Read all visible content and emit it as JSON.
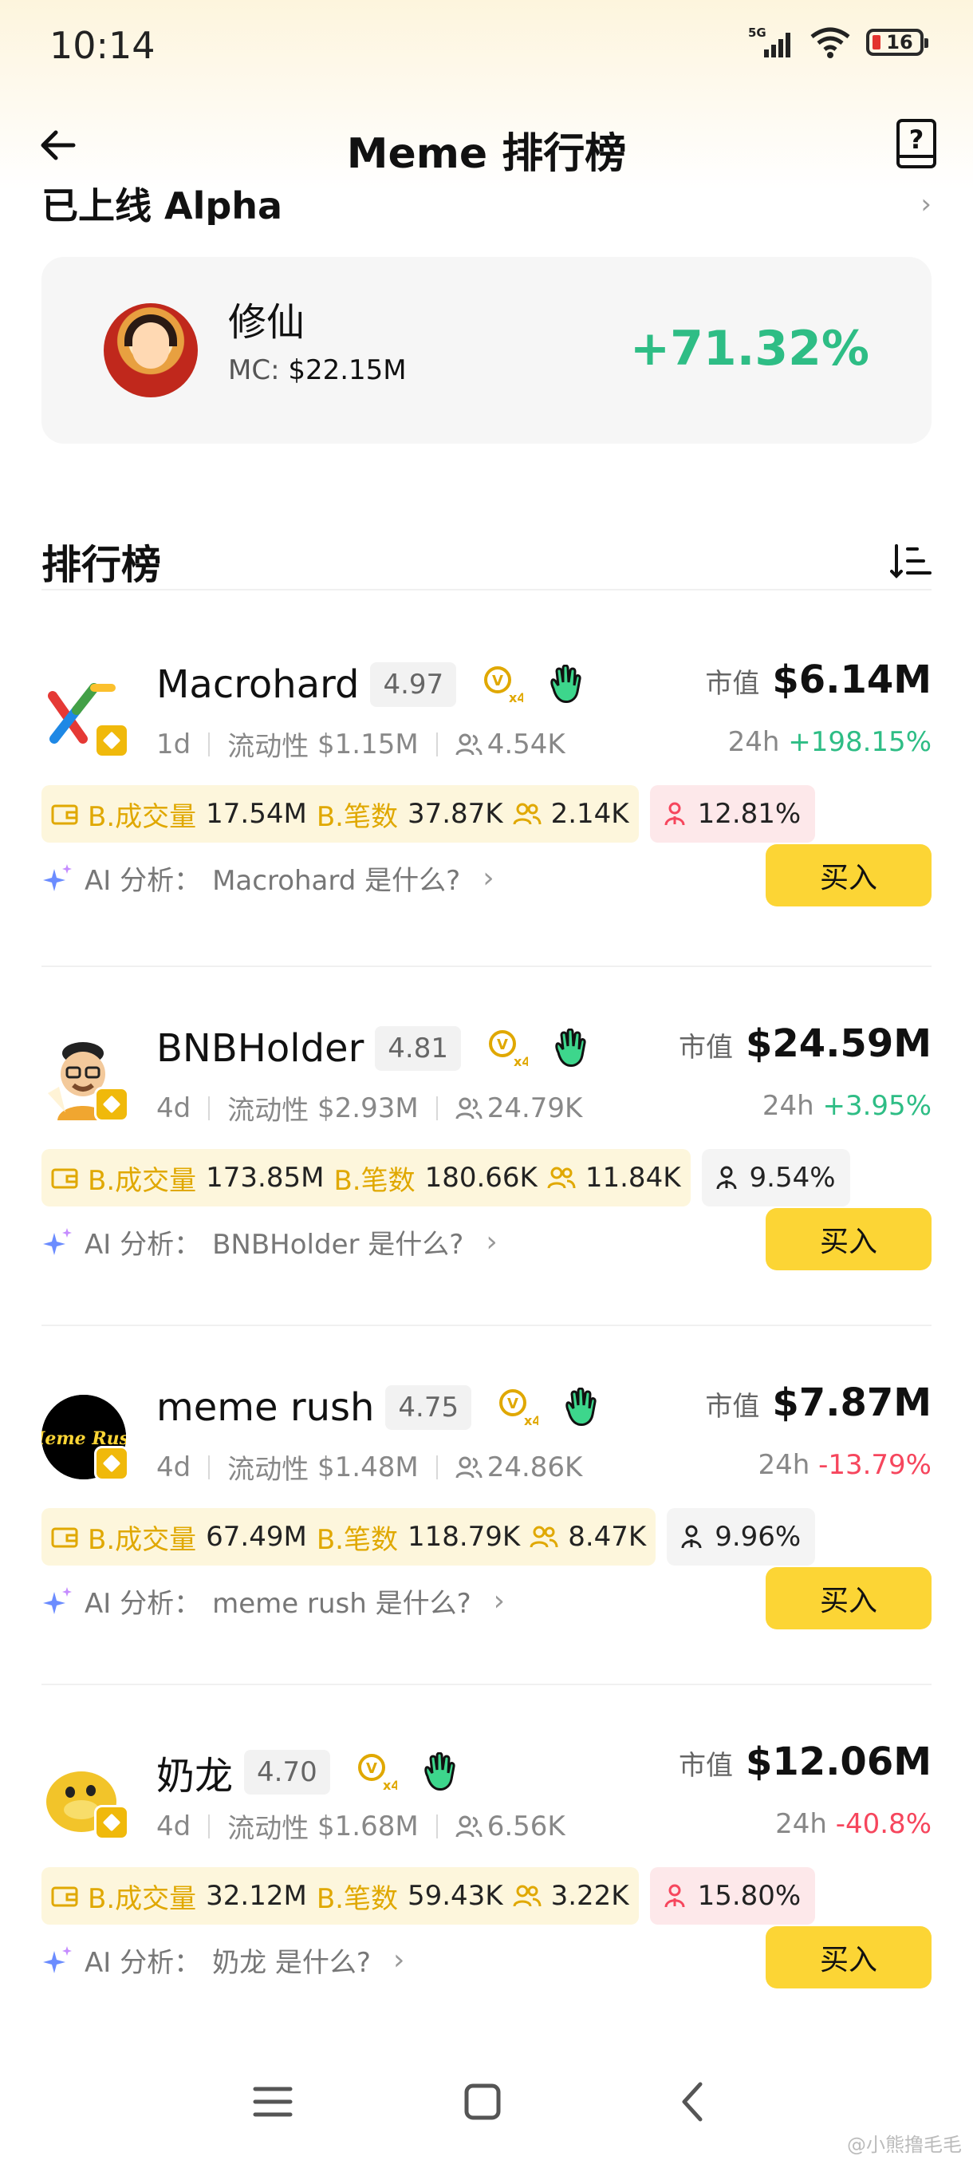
{
  "status_bar": {
    "time": "10:14",
    "network": "5G",
    "battery": "16"
  },
  "header": {
    "title": "Meme 排行榜"
  },
  "alpha": {
    "section_title": "已上线 Alpha",
    "token": {
      "name": "修仙",
      "mc_label": "MC:",
      "mc_value": "$22.15M",
      "change": "+71.32%"
    }
  },
  "ranking": {
    "title": "排行榜",
    "labels": {
      "mcap": "市值",
      "h24": "24h",
      "liquidity": "流动性",
      "volume": "B.成交量",
      "trades": "B.笔数",
      "buy": "买入",
      "ai_prefix": "AI 分析："
    },
    "items": [
      {
        "name": "Macrohard",
        "score": "4.97",
        "age": "1d",
        "liquidity": "$1.15M",
        "holders": "4.54K",
        "mcap": "$6.14M",
        "change": "+198.15%",
        "change_dir": "up",
        "volume": "17.54M",
        "trades": "37.87K",
        "traders": "2.14K",
        "pct": "12.81%",
        "pct_style": "red",
        "ai": "Macrohard 是什么?"
      },
      {
        "name": "BNBHolder",
        "score": "4.81",
        "age": "4d",
        "liquidity": "$2.93M",
        "holders": "24.79K",
        "mcap": "$24.59M",
        "change": "+3.95%",
        "change_dir": "up",
        "volume": "173.85M",
        "trades": "180.66K",
        "traders": "11.84K",
        "pct": "9.54%",
        "pct_style": "gray",
        "ai": "BNBHolder 是什么?"
      },
      {
        "name": "meme rush",
        "score": "4.75",
        "age": "4d",
        "liquidity": "$1.48M",
        "holders": "24.86K",
        "mcap": "$7.87M",
        "change": "-13.79%",
        "change_dir": "down",
        "volume": "67.49M",
        "trades": "118.79K",
        "traders": "8.47K",
        "pct": "9.96%",
        "pct_style": "gray",
        "ai": "meme rush 是什么?"
      },
      {
        "name": "奶龙",
        "score": "4.70",
        "age": "4d",
        "liquidity": "$1.68M",
        "holders": "6.56K",
        "mcap": "$12.06M",
        "change": "-40.8%",
        "change_dir": "down",
        "volume": "32.12M",
        "trades": "59.43K",
        "traders": "3.22K",
        "pct": "15.80%",
        "pct_style": "red",
        "ai": "奶龙 是什么?"
      }
    ]
  },
  "logo_texts": {
    "meme_rush": "Meme Rush"
  },
  "watermark": "@小熊撸毛毛",
  "colors": {
    "up": "#2ebd85",
    "down": "#f6465d",
    "brand": "#fcd535",
    "tag_label": "#e0a800"
  }
}
